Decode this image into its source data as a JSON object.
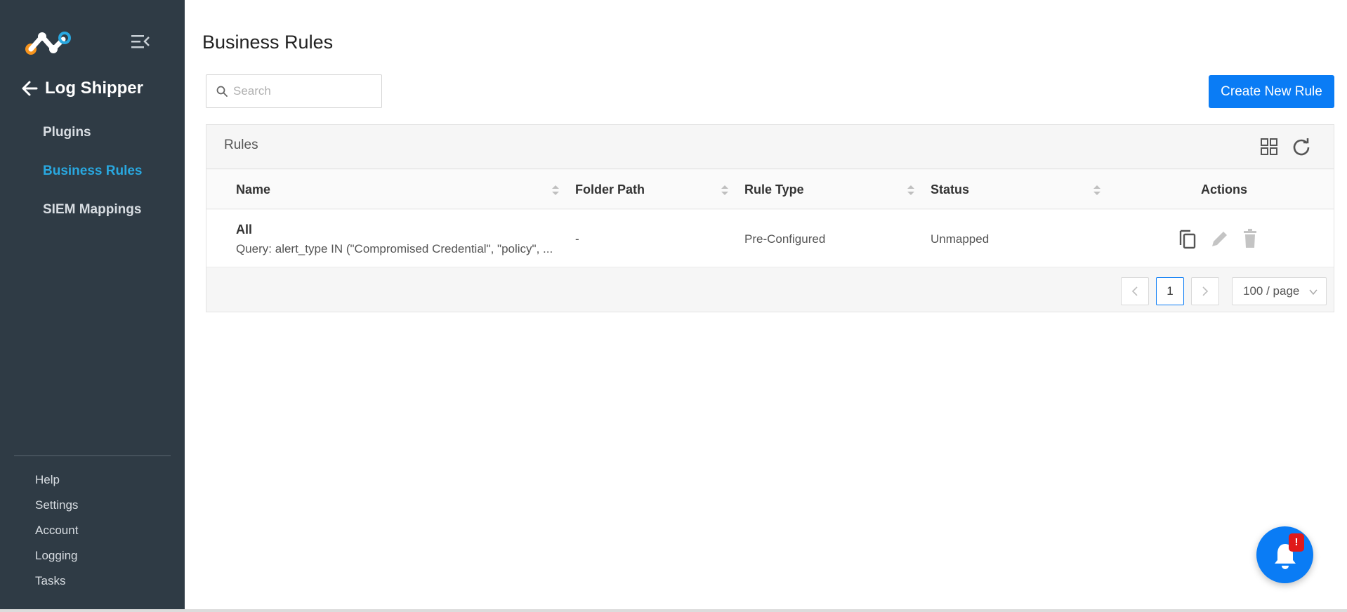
{
  "sidebar": {
    "back_title": "Log Shipper",
    "items": [
      {
        "label": "Plugins",
        "active": false
      },
      {
        "label": "Business Rules",
        "active": true
      },
      {
        "label": "SIEM Mappings",
        "active": false
      }
    ],
    "bottom_items": [
      {
        "label": "Help"
      },
      {
        "label": "Settings"
      },
      {
        "label": "Account"
      },
      {
        "label": "Logging"
      },
      {
        "label": "Tasks"
      }
    ]
  },
  "header": {
    "title": "Business Rules"
  },
  "search": {
    "placeholder": "Search",
    "value": ""
  },
  "toolbar": {
    "create_label": "Create New Rule"
  },
  "rules_card": {
    "title": "Rules",
    "columns": [
      "Name",
      "Folder Path",
      "Rule Type",
      "Status",
      "Actions"
    ],
    "rows": [
      {
        "name": "All",
        "query": "Query: alert_type IN (\"Compromised Credential\", \"policy\", ...",
        "folder_path": "-",
        "rule_type": "Pre-Configured",
        "status": "Unmapped"
      }
    ]
  },
  "pagination": {
    "current_page": "1",
    "page_size": "100 / page"
  },
  "notifications": {
    "badge": "!"
  },
  "colors": {
    "sidebar_bg": "#2f3b45",
    "active_nav": "#29a8e0",
    "primary": "#0a7cf5",
    "badge": "#e01a1a"
  },
  "icons": {
    "logo": "brand-logo-icon",
    "collapse": "menu-collapse-icon",
    "back": "arrow-left-icon",
    "search": "search-icon",
    "grid": "grid-view-icon",
    "refresh": "refresh-icon",
    "copy": "copy-icon",
    "edit": "pencil-icon",
    "delete": "trash-icon",
    "bell": "bell-icon"
  }
}
